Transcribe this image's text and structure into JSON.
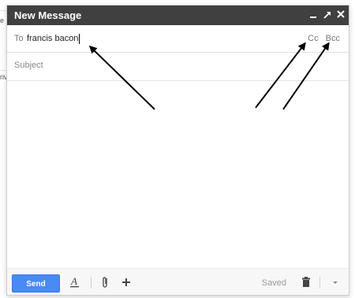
{
  "background": {
    "fragments": [
      "e",
      "riv"
    ]
  },
  "compose": {
    "title": "New Message",
    "controls": [
      "minimize-icon",
      "pop-out-icon",
      "close-icon"
    ],
    "to": {
      "label": "To",
      "value": "francis bacon"
    },
    "cc_label": "Cc",
    "bcc_label": "Bcc",
    "subject": {
      "placeholder": "Subject",
      "value": ""
    },
    "body": "",
    "footer": {
      "send_label": "Send",
      "formatting_icon": "text-format-icon",
      "attach_icon": "paperclip-icon",
      "more_icon": "plus-icon",
      "saved_label": "Saved",
      "discard_icon": "trash-icon",
      "options_icon": "chevron-down-icon"
    }
  },
  "colors": {
    "titlebar": "#404040",
    "send_button": "#4a8af4",
    "arrow": "#000000"
  }
}
